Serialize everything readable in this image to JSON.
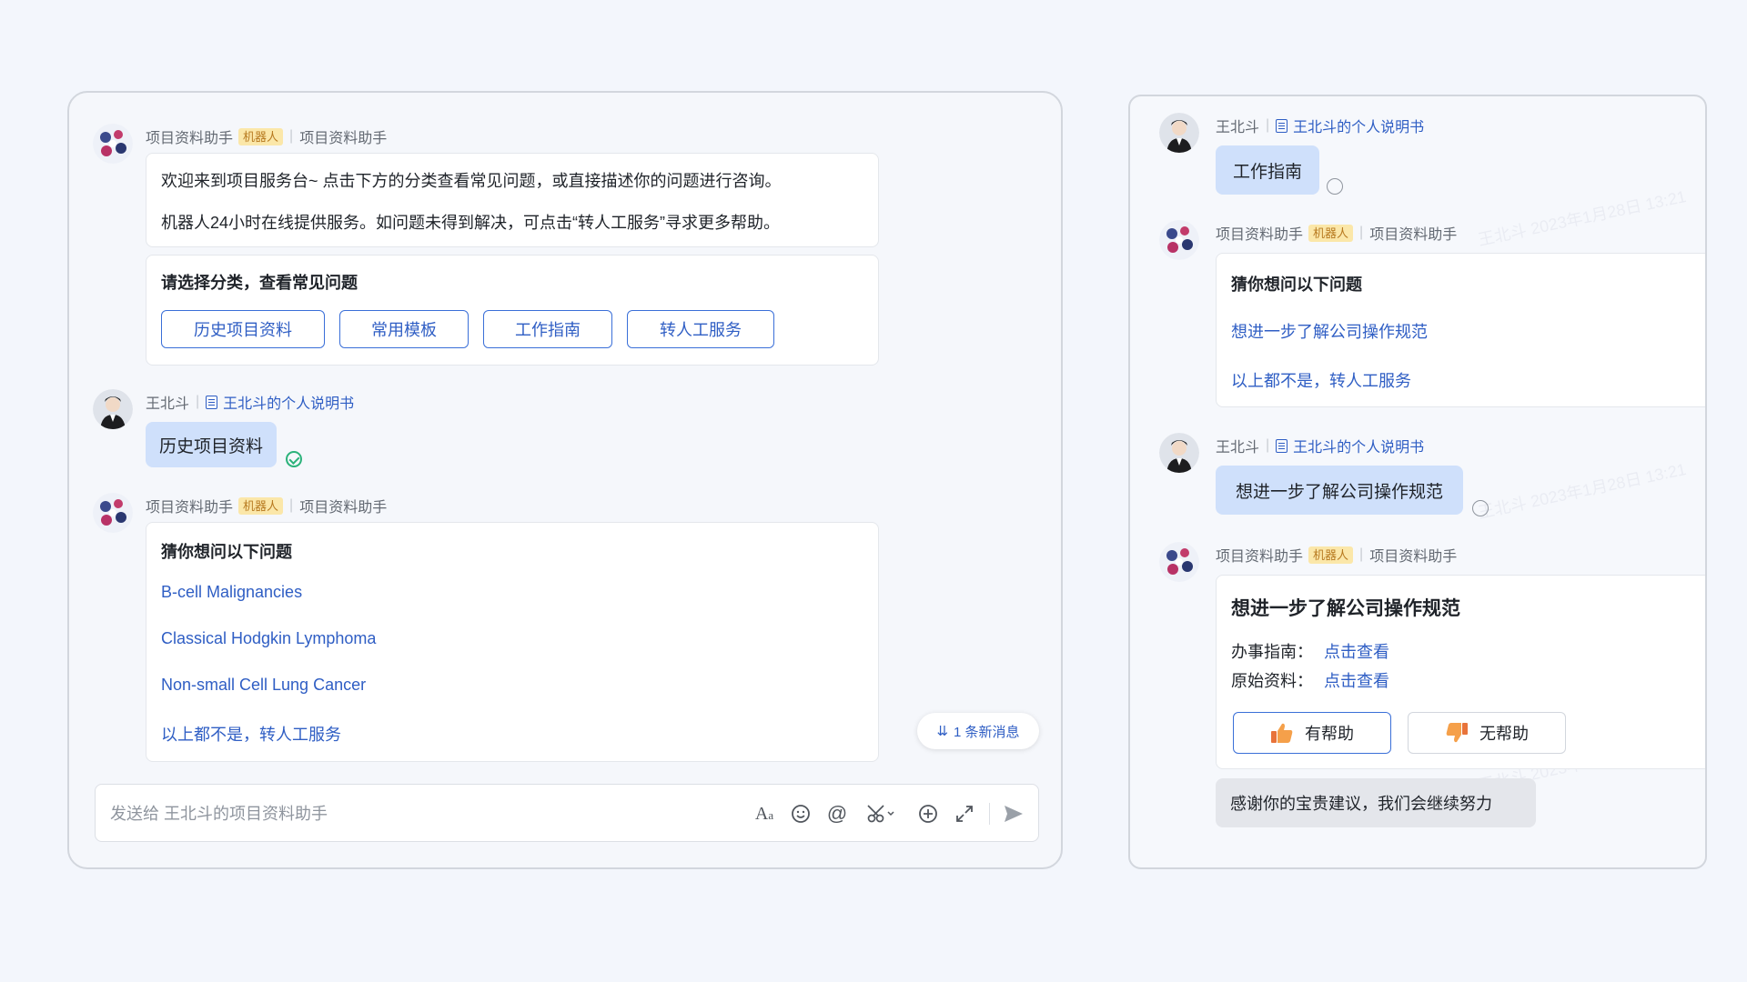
{
  "left": {
    "header1": {
      "bot_name": "项目资料助手",
      "robot_tag": "机器人",
      "subtitle": "项目资料助手"
    },
    "welcome": {
      "line1": "欢迎来到项目服务台~ 点击下方的分类查看常见问题，或直接描述你的问题进行咨询。",
      "line2": "机器人24小时在线提供服务。如问题未得到解决，可点击“转人工服务”寻求更多帮助。"
    },
    "category": {
      "title": "请选择分类，查看常见问题",
      "buttons": [
        "历史项目资料",
        "常用模板",
        "工作指南",
        "转人工服务"
      ]
    },
    "user_msg": {
      "name": "王北斗",
      "doc_link": "王北斗的个人说明书",
      "text": "历史项目资料"
    },
    "header2": {
      "bot_name": "项目资料助手",
      "robot_tag": "机器人",
      "subtitle": "项目资料助手"
    },
    "suggest": {
      "title": "猜你想问以下问题",
      "links": [
        "B-cell Malignancies",
        "Classical Hodgkin Lymphoma",
        "Non-small Cell Lung Cancer",
        "以上都不是，转人工服务"
      ]
    },
    "new_msg": "1 条新消息",
    "input": {
      "placeholder": "发送给 王北斗的项目资料助手",
      "value": ""
    }
  },
  "right": {
    "user_msg1": {
      "name": "王北斗",
      "doc_link": "王北斗的个人说明书",
      "text": "工作指南"
    },
    "header1": {
      "bot_name": "项目资料助手",
      "robot_tag": "机器人",
      "subtitle": "项目资料助手"
    },
    "suggest": {
      "title": "猜你想问以下问题",
      "links": [
        "想进一步了解公司操作规范",
        "以上都不是，转人工服务"
      ]
    },
    "user_msg2": {
      "name": "王北斗",
      "doc_link": "王北斗的个人说明书",
      "text": "想进一步了解公司操作规范"
    },
    "header2": {
      "bot_name": "项目资料助手",
      "robot_tag": "机器人",
      "subtitle": "项目资料助手"
    },
    "answer": {
      "title": "想进一步了解公司操作规范",
      "row1_label": "办事指南：",
      "row1_link": "点击查看",
      "row2_label": "原始资料：",
      "row2_link": "点击查看",
      "helpful": "有帮助",
      "not_helpful": "无帮助"
    },
    "thanks": "感谢你的宝贵建议，我们会继续努力",
    "watermark": "王北斗 2023年1月28日 13:21"
  },
  "colors": {
    "accent": "#2f5ec4",
    "bubble": "#cfe0fb",
    "robot_tag_bg": "#fbe7a9",
    "success": "#2bb27a"
  },
  "icons": [
    "bot-avatar",
    "user-avatar",
    "doc-icon",
    "check-circle-icon",
    "pending-circle-icon",
    "double-chevron-down-icon",
    "font-format-icon",
    "emoji-icon",
    "mention-icon",
    "scissors-icon",
    "plus-circle-icon",
    "expand-icon",
    "send-icon",
    "thumbs-up-icon",
    "thumbs-down-icon"
  ]
}
